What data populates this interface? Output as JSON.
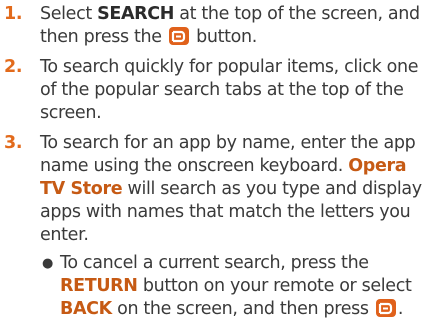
{
  "steps": [
    {
      "number": "1.",
      "t1": "Select ",
      "kw1": "SEARCH",
      "t2": " at the top of the screen, and then press the ",
      "icon": "enter-icon",
      "t3": " button."
    },
    {
      "number": "2.",
      "text": "To search quickly for popular items, click one of the popular search tabs at the top of the screen."
    },
    {
      "number": "3.",
      "t1": "To search for an app by name, enter the app name using the onscreen keyboard. ",
      "kw1": "Opera TV Store",
      "t2": " will search as you type and display apps with names that match the letters you enter."
    }
  ],
  "bullet": {
    "t1": "To cancel a current search, press the ",
    "kw1": "RETURN",
    "t2": " button on your remote or select ",
    "kw2": "BACK",
    "t3": " on the screen, and then press ",
    "icon": "enter-icon",
    "t4": "."
  },
  "colors": {
    "step_number": "#e26a1b",
    "highlight_orange": "#c65a14",
    "enter_key": "#e0611b",
    "text": "#3a3a3a"
  }
}
